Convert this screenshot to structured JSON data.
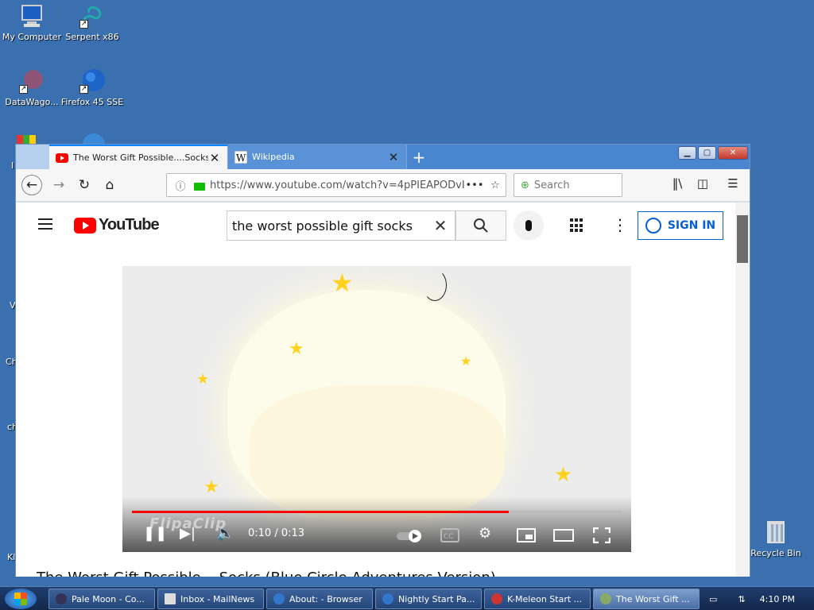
{
  "desktop": {
    "icons": [
      {
        "label": "My Computer"
      },
      {
        "label": "Serpent x86"
      },
      {
        "label": "DataWago..."
      },
      {
        "label": "Firefox 45 SSE"
      },
      {
        "label": "Recycle Bin"
      }
    ],
    "partial_labels": [
      "I",
      "V",
      "Ch",
      "ch",
      "Kl"
    ]
  },
  "browser": {
    "tabs": [
      {
        "title": "The Worst Gift Possible....Socks",
        "close": "✕"
      },
      {
        "title": "Wikipedia",
        "close": "✕"
      }
    ],
    "new_tab": "+",
    "url": "https://www.youtube.com/watch?v=4pPIEAPODvI",
    "page_actions": "•••",
    "search_placeholder": "Search",
    "window_buttons": {
      "minimize": "▁",
      "maximize": "▢",
      "close": "✕"
    }
  },
  "youtube": {
    "logo_text": "YouTube",
    "search_query": "the worst possible gift socks",
    "clear": "✕",
    "sign_in": "SIGN IN",
    "player": {
      "time": "0:10 / 0:13",
      "progress": 0.77,
      "watermark": "FlipaClip"
    },
    "video_title": "The Worst Gift Possible....Socks (Blue Circle Adventures Version)"
  },
  "taskbar": {
    "items": [
      {
        "label": "Pale Moon - Co...",
        "active": false
      },
      {
        "label": "Inbox - MailNews",
        "active": false
      },
      {
        "label": "About: - Browser",
        "active": false
      },
      {
        "label": "Nightly Start Pa...",
        "active": false
      },
      {
        "label": "K-Meleon Start ...",
        "active": false
      },
      {
        "label": "The Worst Gift ...",
        "active": true
      }
    ],
    "clock": "4:10 PM"
  },
  "colors": {
    "accent": "#0a84ff",
    "youtube_red": "#ff0000",
    "desktop": "#3a6fb0"
  }
}
